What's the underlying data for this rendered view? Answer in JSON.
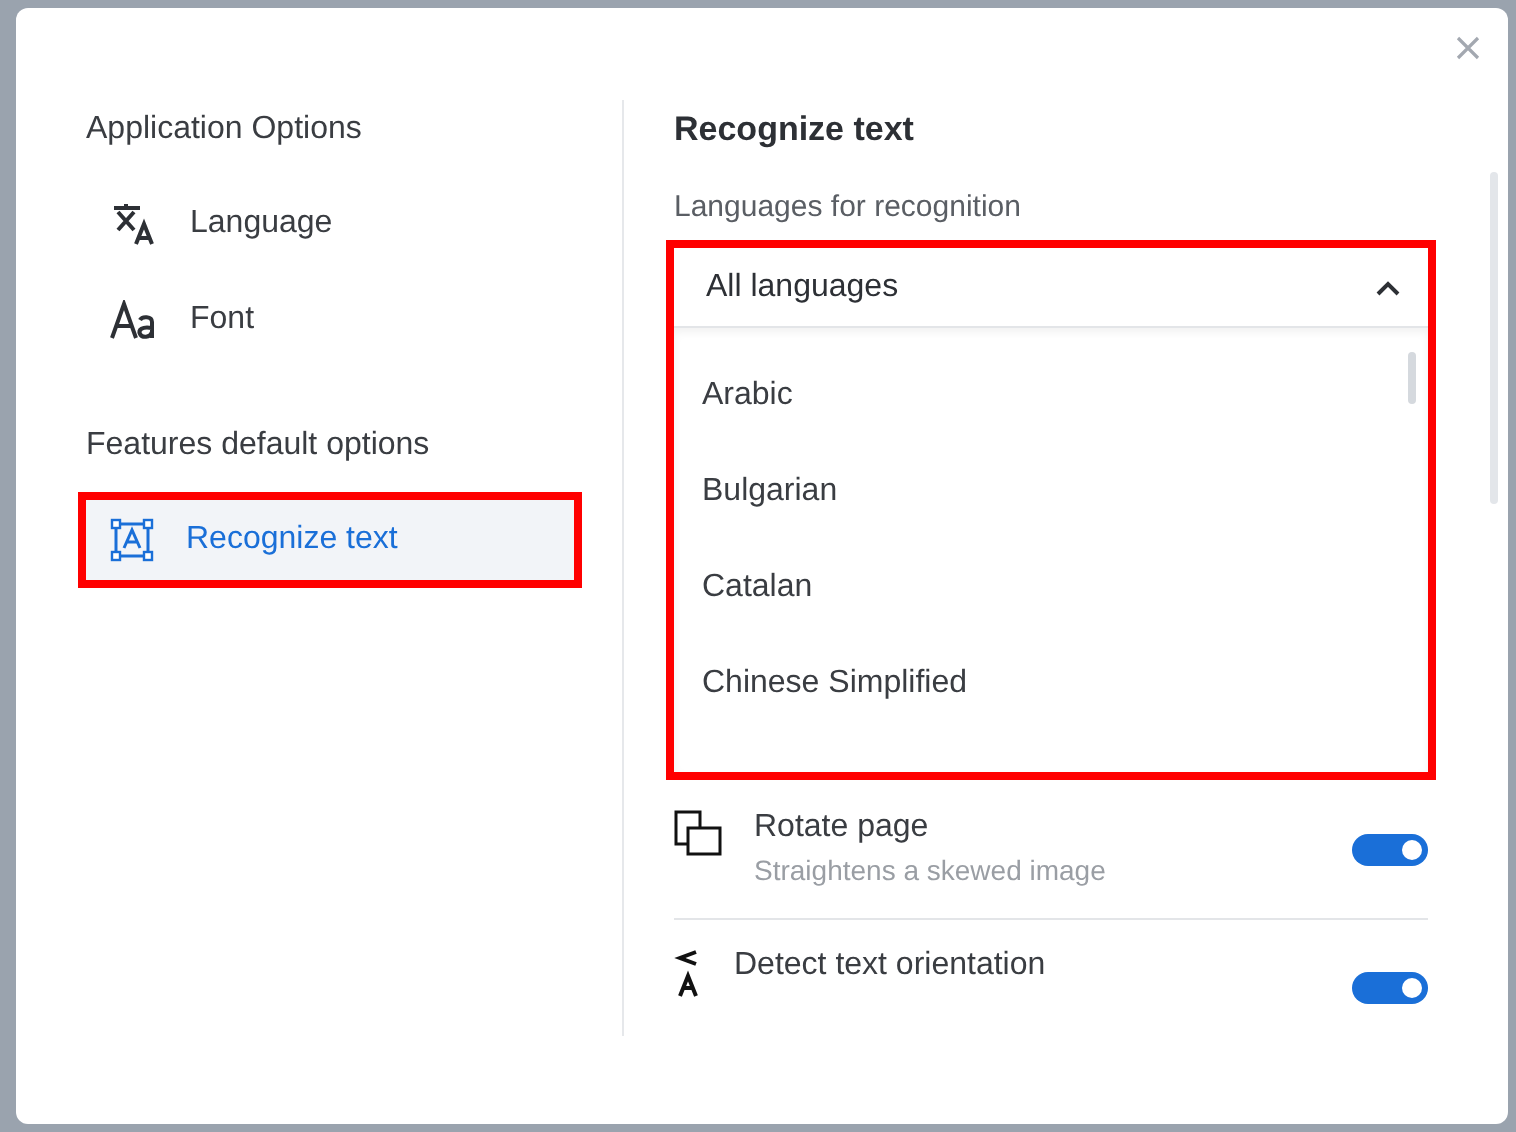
{
  "sidebar": {
    "sections": [
      {
        "title": "Application Options",
        "items": [
          {
            "label": "Language",
            "kind": "translate",
            "selected": false,
            "highlighted": false
          },
          {
            "label": "Font",
            "kind": "font",
            "selected": false,
            "highlighted": false
          }
        ]
      },
      {
        "title": "Features default options",
        "items": [
          {
            "label": "Recognize text",
            "kind": "recognize",
            "selected": true,
            "highlighted": true
          }
        ]
      }
    ]
  },
  "panel": {
    "title": "Recognize text",
    "languages": {
      "label": "Languages for recognition",
      "value": "All languages",
      "expanded": true,
      "highlighted": true,
      "options": [
        "Arabic",
        "Bulgarian",
        "Catalan",
        "Chinese Simplified"
      ]
    },
    "settings": [
      {
        "kind": "rotate",
        "title": "Rotate page",
        "description": "Straightens a skewed image",
        "on": true
      },
      {
        "kind": "orientation",
        "title": "Detect text orientation",
        "on": true
      }
    ]
  }
}
